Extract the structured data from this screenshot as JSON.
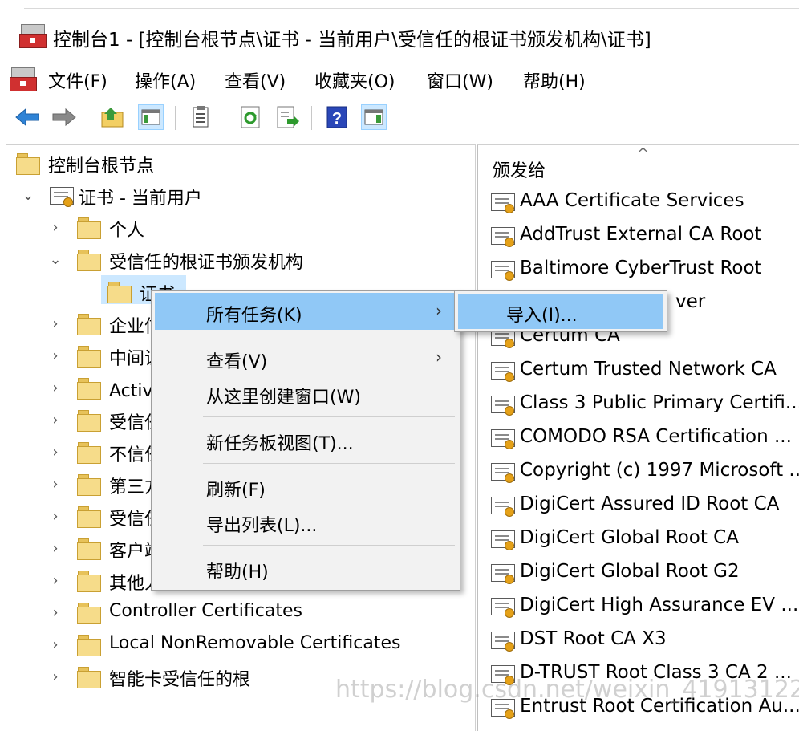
{
  "window": {
    "title": "控制台1 - [控制台根节点\\证书 - 当前用户\\受信任的根证书颁发机构\\证书]"
  },
  "menu": [
    "文件(F)",
    "操作(A)",
    "查看(V)",
    "收藏夹(O)",
    "窗口(W)",
    "帮助(H)"
  ],
  "toolbar": [
    "back-icon",
    "forward-icon",
    "up-folder-icon",
    "show-tree-icon",
    "properties-icon",
    "refresh-icon",
    "export-list-icon",
    "help-icon",
    "action-pane-icon"
  ],
  "tree": {
    "root": "控制台根节点",
    "cert_store": "证书 - 当前用户",
    "items": [
      {
        "label": "个人"
      },
      {
        "label": "受信任的根证书颁发机构"
      },
      {
        "label": "证书"
      },
      {
        "label": "企业信任"
      },
      {
        "label": "中间证书颁发机构"
      },
      {
        "label": "Active Directory 用户对象"
      },
      {
        "label": "受信任的发布者"
      },
      {
        "label": "不信任的证书"
      },
      {
        "label": "第三方根证书颁发机构"
      },
      {
        "label": "受信任人"
      },
      {
        "label": "客户端身份验证颁发者"
      },
      {
        "label": "其他人"
      },
      {
        "label": "Controller Certificates"
      },
      {
        "label": "Local NonRemovable Certificates"
      },
      {
        "label": "智能卡受信任的根"
      }
    ]
  },
  "list": {
    "column_header": "颁发给",
    "certificates": [
      "AAA Certificate Services",
      "AddTrust External CA Root",
      "Baltimore CyberTrust Root",
      "Certum CA",
      "Certum Trusted Network CA",
      "Class 3 Public Primary Certifi...",
      "COMODO RSA Certification ...",
      "Copyright (c) 1997 Microsoft ...",
      "DigiCert Assured ID Root CA",
      "DigiCert Global Root CA",
      "DigiCert Global Root G2",
      "DigiCert High Assurance EV ...",
      "DST Root CA X3",
      "D-TRUST Root Class 3 CA 2 ...",
      "Entrust Root Certification Au..."
    ],
    "partial_hidden_text": "ver"
  },
  "context_menu": {
    "all_tasks": "所有任务(K)",
    "view": "查看(V)",
    "new_window": "从这里创建窗口(W)",
    "new_taskpad": "新任务板视图(T)...",
    "refresh": "刷新(F)",
    "export_list": "导出列表(L)...",
    "help": "帮助(H)"
  },
  "submenu": {
    "import": "导入(I)..."
  },
  "watermark": "https://blog.csdn.net/weixin_41913122",
  "colors": {
    "highlight": "#90c8f6",
    "selection": "#cce8ff",
    "folder": "#f6dc8a"
  }
}
